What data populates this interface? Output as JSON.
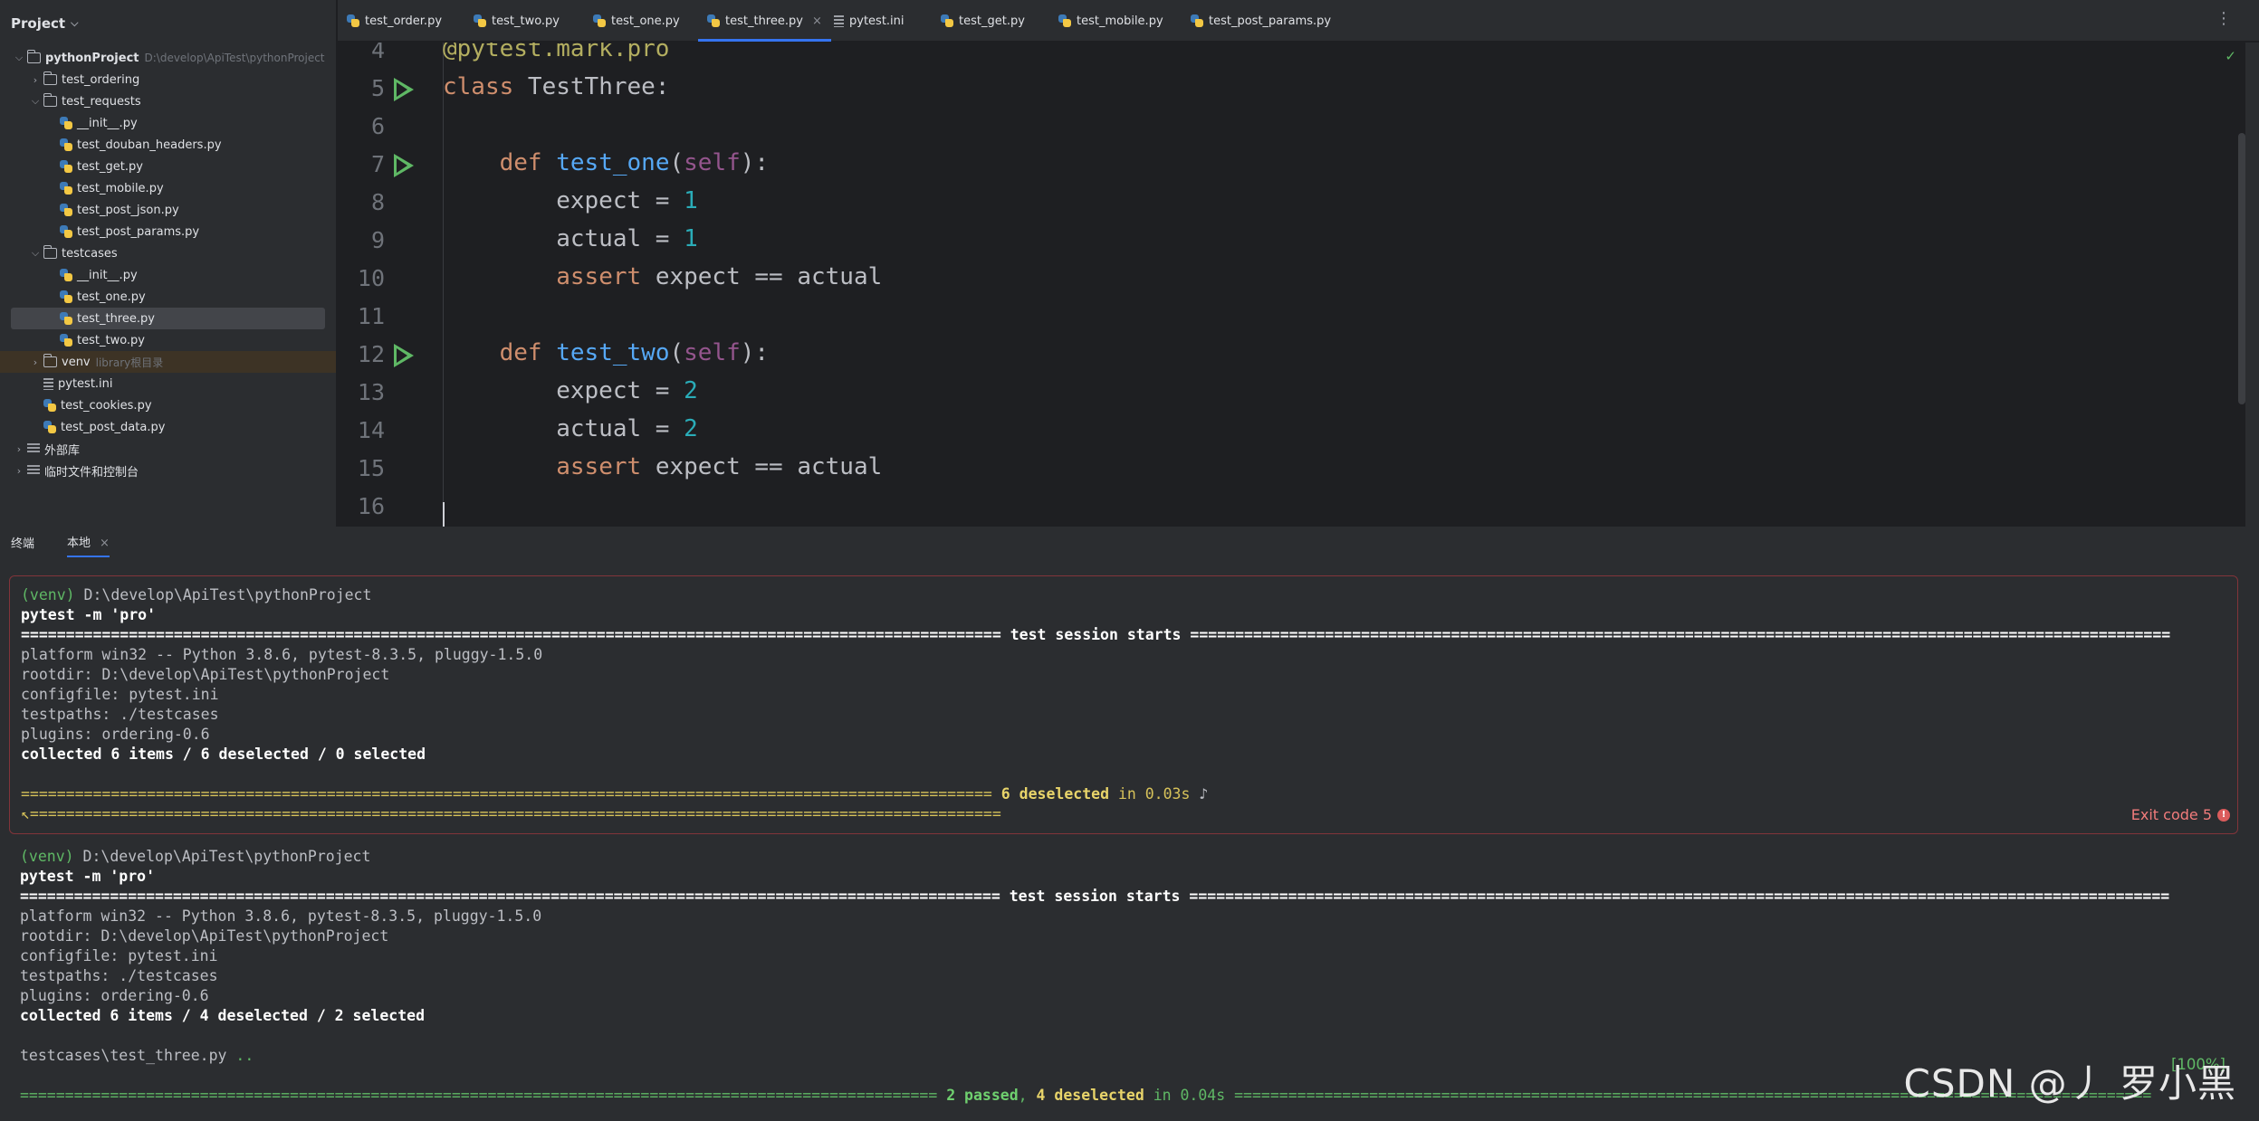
{
  "project": {
    "title": "Project",
    "tree": [
      {
        "label": "pythonProject",
        "hint": "D:\\develop\\ApiTest\\pythonProject",
        "kind": "folder",
        "expanded": true,
        "bold": true
      },
      {
        "label": "test_ordering",
        "kind": "folder",
        "expanded": false
      },
      {
        "label": "test_requests",
        "kind": "folder",
        "expanded": true
      },
      {
        "label": "__init__.py",
        "kind": "py"
      },
      {
        "label": "test_douban_headers.py",
        "kind": "py"
      },
      {
        "label": "test_get.py",
        "kind": "py"
      },
      {
        "label": "test_mobile.py",
        "kind": "py"
      },
      {
        "label": "test_post_json.py",
        "kind": "py"
      },
      {
        "label": "test_post_params.py",
        "kind": "py"
      },
      {
        "label": "testcases",
        "kind": "folder",
        "expanded": true
      },
      {
        "label": "__init__.py",
        "kind": "py"
      },
      {
        "label": "test_one.py",
        "kind": "py"
      },
      {
        "label": "test_three.py",
        "kind": "py",
        "selected": true
      },
      {
        "label": "test_two.py",
        "kind": "py"
      },
      {
        "label": "venv",
        "hint": "library根目录",
        "kind": "folder",
        "expanded": false,
        "excluded": true
      },
      {
        "label": "pytest.ini",
        "kind": "ini"
      },
      {
        "label": "test_cookies.py",
        "kind": "py"
      },
      {
        "label": "test_post_data.py",
        "kind": "py"
      },
      {
        "label": "外部库",
        "kind": "lib",
        "expanded": false
      },
      {
        "label": "临时文件和控制台",
        "kind": "lib",
        "expanded": false
      }
    ]
  },
  "tabs": [
    {
      "label": "test_order.py",
      "kind": "py"
    },
    {
      "label": "test_two.py",
      "kind": "py"
    },
    {
      "label": "test_one.py",
      "kind": "py"
    },
    {
      "label": "test_three.py",
      "kind": "py",
      "active": true
    },
    {
      "label": "pytest.ini",
      "kind": "ini"
    },
    {
      "label": "test_get.py",
      "kind": "py"
    },
    {
      "label": "test_mobile.py",
      "kind": "py"
    },
    {
      "label": "test_post_params.py",
      "kind": "py"
    }
  ],
  "editor": {
    "lines": [
      {
        "n": "4",
        "segs": [
          [
            "deco",
            "@pytest.mark.pro"
          ]
        ]
      },
      {
        "n": "5",
        "run": true,
        "segs": [
          [
            "kw",
            "class "
          ],
          [
            "",
            "TestThree:"
          ]
        ]
      },
      {
        "n": "6",
        "segs": []
      },
      {
        "n": "7",
        "run": true,
        "segs": [
          [
            "",
            "    "
          ],
          [
            "kw",
            "def "
          ],
          [
            "fn",
            "test_one"
          ],
          [
            "",
            "("
          ],
          [
            "self",
            "self"
          ],
          [
            "",
            "):"
          ]
        ]
      },
      {
        "n": "8",
        "segs": [
          [
            "",
            "        expect = "
          ],
          [
            "num",
            "1"
          ]
        ]
      },
      {
        "n": "9",
        "segs": [
          [
            "",
            "        actual = "
          ],
          [
            "num",
            "1"
          ]
        ]
      },
      {
        "n": "10",
        "segs": [
          [
            "",
            "        "
          ],
          [
            "kw",
            "assert "
          ],
          [
            "",
            "expect == actual"
          ]
        ]
      },
      {
        "n": "11",
        "segs": []
      },
      {
        "n": "12",
        "run": true,
        "segs": [
          [
            "",
            "    "
          ],
          [
            "kw",
            "def "
          ],
          [
            "fn",
            "test_two"
          ],
          [
            "",
            "("
          ],
          [
            "self",
            "self"
          ],
          [
            "",
            "):"
          ]
        ]
      },
      {
        "n": "13",
        "segs": [
          [
            "",
            "        expect = "
          ],
          [
            "num",
            "2"
          ]
        ]
      },
      {
        "n": "14",
        "segs": [
          [
            "",
            "        actual = "
          ],
          [
            "num",
            "2"
          ]
        ]
      },
      {
        "n": "15",
        "segs": [
          [
            "",
            "        "
          ],
          [
            "kw",
            "assert "
          ],
          [
            "",
            "expect == actual"
          ]
        ]
      },
      {
        "n": "16",
        "segs": []
      }
    ]
  },
  "terminal": {
    "title": "终端",
    "tab": "本地",
    "exit_code": "Exit code 5",
    "runs": [
      [
        [
          [
            "venv",
            "(venv) "
          ],
          [
            "",
            "D:\\develop\\ApiTest\\pythonProject"
          ]
        ],
        [
          [
            "bold",
            "pytest -m 'pro'"
          ]
        ],
        [
          [
            "bold",
            "============================================================================================================= test session starts ============================================================================================================="
          ]
        ],
        [
          [
            "",
            "platform win32 -- Python 3.8.6, pytest-8.3.5, pluggy-1.5.0"
          ]
        ],
        [
          [
            "",
            "rootdir: D:\\develop\\ApiTest\\pythonProject"
          ]
        ],
        [
          [
            "",
            "configfile: pytest.ini"
          ]
        ],
        [
          [
            "",
            "testpaths: ./testcases"
          ]
        ],
        [
          [
            "",
            "plugins: ordering-0.6"
          ]
        ],
        [
          [
            "bold",
            "collected 6 items / 6 deselected / 0 selected"
          ]
        ],
        [],
        [
          [
            "yellow",
            "============================================================================================================ "
          ],
          [
            "ybold",
            "6 deselected"
          ],
          [
            "yellow",
            " in 0.03s"
          ],
          [
            "",
            " ♪"
          ]
        ],
        [
          [
            "yellow",
            "↖============================================================================================================"
          ]
        ]
      ],
      [
        [
          [
            "venv",
            "(venv) "
          ],
          [
            "",
            "D:\\develop\\ApiTest\\pythonProject"
          ]
        ],
        [
          [
            "bold",
            "pytest -m 'pro'"
          ]
        ],
        [
          [
            "bold",
            "============================================================================================================= test session starts ============================================================================================================="
          ]
        ],
        [
          [
            "",
            "platform win32 -- Python 3.8.6, pytest-8.3.5, pluggy-1.5.0"
          ]
        ],
        [
          [
            "",
            "rootdir: D:\\develop\\ApiTest\\pythonProject"
          ]
        ],
        [
          [
            "",
            "configfile: pytest.ini"
          ]
        ],
        [
          [
            "",
            "testpaths: ./testcases"
          ]
        ],
        [
          [
            "",
            "plugins: ordering-0.6"
          ]
        ],
        [
          [
            "bold",
            "collected 6 items / 4 deselected / 2 selected"
          ]
        ],
        [],
        [
          [
            "",
            "testcases\\test_three.py "
          ],
          [
            "green",
            ".."
          ]
        ],
        [],
        [
          [
            "green",
            "====================================================================================================== "
          ],
          [
            "gbold",
            "2 passed"
          ],
          [
            "green",
            ", "
          ],
          [
            "ybold",
            "4 deselected"
          ],
          [
            "green",
            " in 0.04s"
          ],
          [
            "green",
            " ======================================================================================================"
          ]
        ]
      ]
    ],
    "progress": "[100%]"
  },
  "watermark": "CSDN @丿 罗小黑"
}
